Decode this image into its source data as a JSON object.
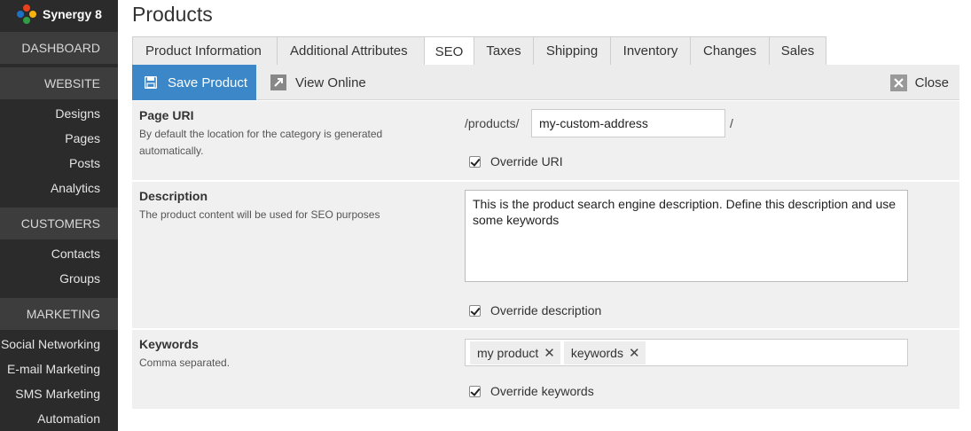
{
  "brand": {
    "name": "Synergy 8"
  },
  "sidebar": {
    "sections": [
      {
        "label": "DASHBOARD",
        "items": []
      },
      {
        "label": "WEBSITE",
        "items": [
          "Designs",
          "Pages",
          "Posts",
          "Analytics"
        ]
      },
      {
        "label": "CUSTOMERS",
        "items": [
          "Contacts",
          "Groups"
        ]
      },
      {
        "label": "MARKETING",
        "items": [
          "Social Networking",
          "E-mail Marketing",
          "SMS Marketing",
          "Automation"
        ]
      }
    ]
  },
  "page": {
    "title": "Products"
  },
  "tabs": [
    {
      "label": "Product Information",
      "active": false
    },
    {
      "label": "Additional Attributes",
      "active": false
    },
    {
      "label": "SEO",
      "active": true
    },
    {
      "label": "Taxes",
      "active": false
    },
    {
      "label": "Shipping",
      "active": false
    },
    {
      "label": "Inventory",
      "active": false
    },
    {
      "label": "Changes",
      "active": false
    },
    {
      "label": "Sales",
      "active": false
    }
  ],
  "toolbar": {
    "save_label": "Save Product",
    "view_label": "View Online",
    "close_label": "Close"
  },
  "seo": {
    "uri": {
      "label": "Page URI",
      "hint": "By default the location for the category is generated automatically.",
      "prefix": "/products/",
      "value": "my-custom-address",
      "suffix": "/",
      "override_label": "Override URI"
    },
    "description": {
      "label": "Description",
      "hint": "The product content will be used for SEO purposes",
      "value": "This is the product search engine description. Define this description and use some keywords",
      "override_label": "Override description"
    },
    "keywords": {
      "label": "Keywords",
      "hint": "Comma separated.",
      "tags": [
        "my product",
        "keywords"
      ],
      "remove_glyph": "✕",
      "override_label": "Override keywords"
    }
  },
  "colors": {
    "accent": "#3b87c7",
    "sidebar_bg": "#2b2b2b",
    "sidebar_section": "#3d3d3d",
    "panel_bg": "#f0f0f0"
  }
}
